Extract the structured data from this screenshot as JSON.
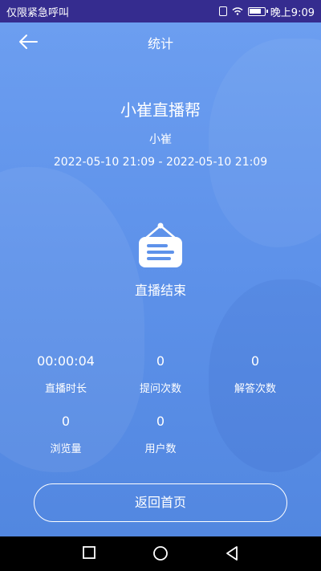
{
  "status_bar": {
    "left_text": "仅限紧急呼叫",
    "time": "晚上9:09"
  },
  "header": {
    "title": "统计",
    "back_icon": "arrow-left-icon"
  },
  "live": {
    "title": "小崔直播帮",
    "host": "小崔",
    "time_range": "2022-05-10 21:09 - 2022-05-10 21:09",
    "ended_label": "直播结束",
    "ended_icon": "hanging-sign-icon"
  },
  "stats": [
    {
      "value": "00:00:04",
      "label": "直播时长"
    },
    {
      "value": "0",
      "label": "提问次数"
    },
    {
      "value": "0",
      "label": "解答次数"
    },
    {
      "value": "0",
      "label": "浏览量"
    },
    {
      "value": "0",
      "label": "用户数"
    }
  ],
  "footer": {
    "home_button_label": "返回首页"
  },
  "nav": {
    "recent_icon": "square-icon",
    "home_icon": "circle-icon",
    "back_icon": "triangle-back-icon"
  },
  "colors": {
    "status_bar": "#352c8f",
    "background": "#5e92ea",
    "text": "#ffffff"
  }
}
